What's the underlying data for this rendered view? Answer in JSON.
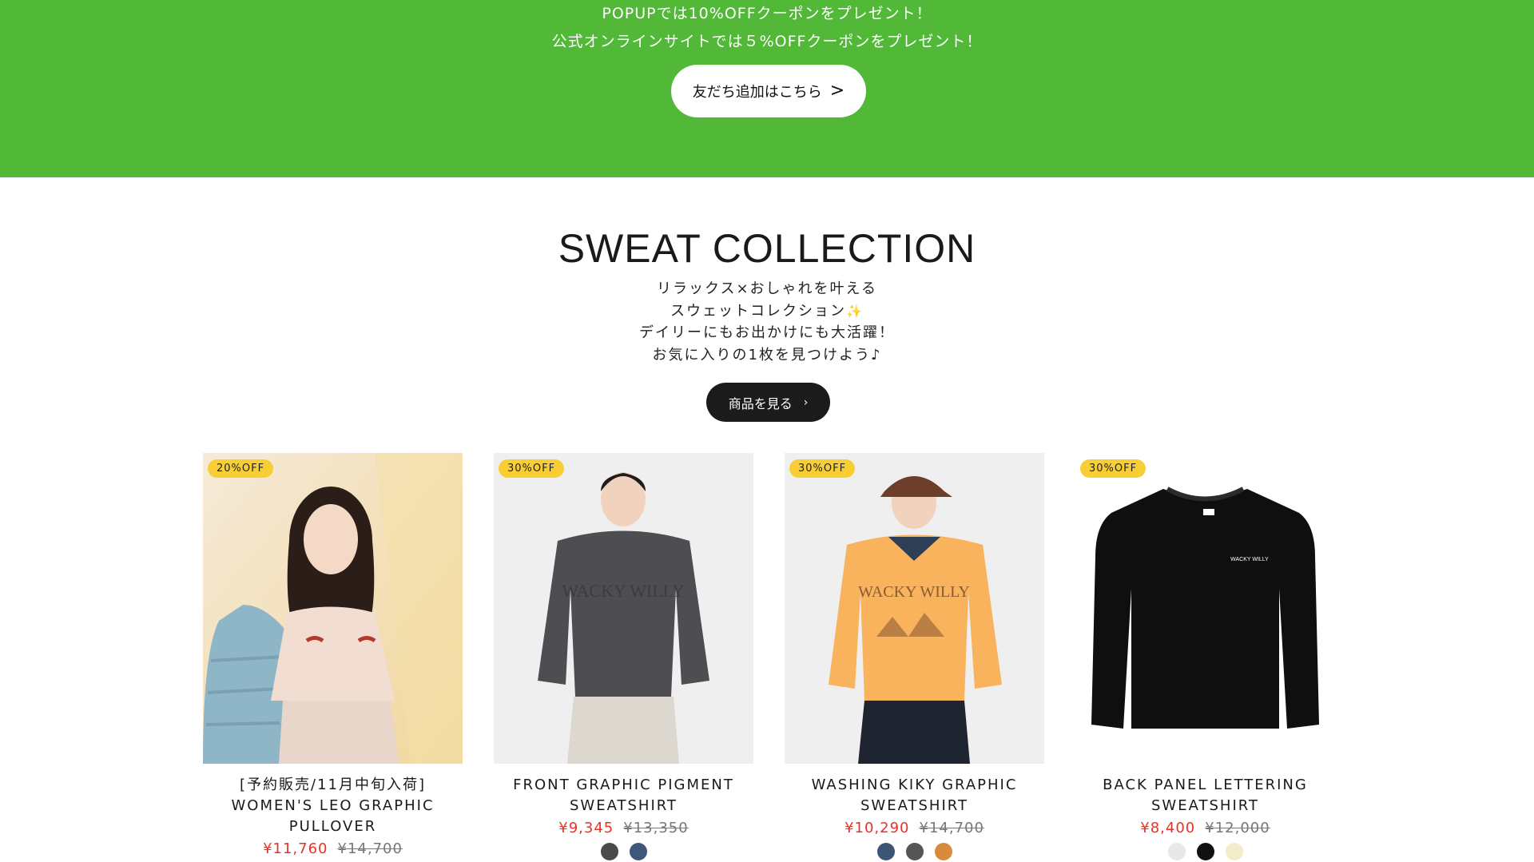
{
  "banner": {
    "line1": "POPUPでは10%OFFクーポンをプレゼント！",
    "line2": "公式オンラインサイトでは５%OFFクーポンをプレゼント！",
    "button_label": "友だち追加はこちら",
    "button_icon": "chevron-right-icon",
    "background": "#52b838"
  },
  "section": {
    "title": "SWEAT COLLECTION",
    "desc": [
      "リラックス×おしゃれを叶える",
      "スウェットコレクション",
      "デイリーにもお出かけにも大活躍！",
      "お気に入りの1枚を見つけよう♪"
    ],
    "sparkle_icon": "sparkle-icon",
    "view_button": "商品を見る"
  },
  "products": [
    {
      "badge": "20%OFF",
      "name_lines": [
        "[予約販売/11月中旬入荷]",
        "WOMEN'S LEO GRAPHIC",
        "PULLOVER"
      ],
      "sale_price": "¥11,760",
      "original_price": "¥14,700",
      "swatches": []
    },
    {
      "badge": "30%OFF",
      "name_lines": [
        "FRONT GRAPHIC PIGMENT",
        "SWEATSHIRT"
      ],
      "sale_price": "¥9,345",
      "original_price": "¥13,350",
      "swatches": [
        "#4a4a4a",
        "#3d5878"
      ]
    },
    {
      "badge": "30%OFF",
      "name_lines": [
        "WASHING KIKY GRAPHIC",
        "SWEATSHIRT"
      ],
      "sale_price": "¥10,290",
      "original_price": "¥14,700",
      "swatches": [
        "#3b5574",
        "#555555",
        "#d98a3a"
      ]
    },
    {
      "badge": "30%OFF",
      "name_lines": [
        "BACK PANEL LETTERING",
        "SWEATSHIRT"
      ],
      "sale_price": "¥8,400",
      "original_price": "¥12,000",
      "swatches": [
        "#e8e8e8",
        "#111111",
        "#f3ecc9"
      ]
    }
  ],
  "colors": {
    "badge": "#f7cf34",
    "sale_price": "#e4342a",
    "view_button": "#1b1b1b"
  }
}
